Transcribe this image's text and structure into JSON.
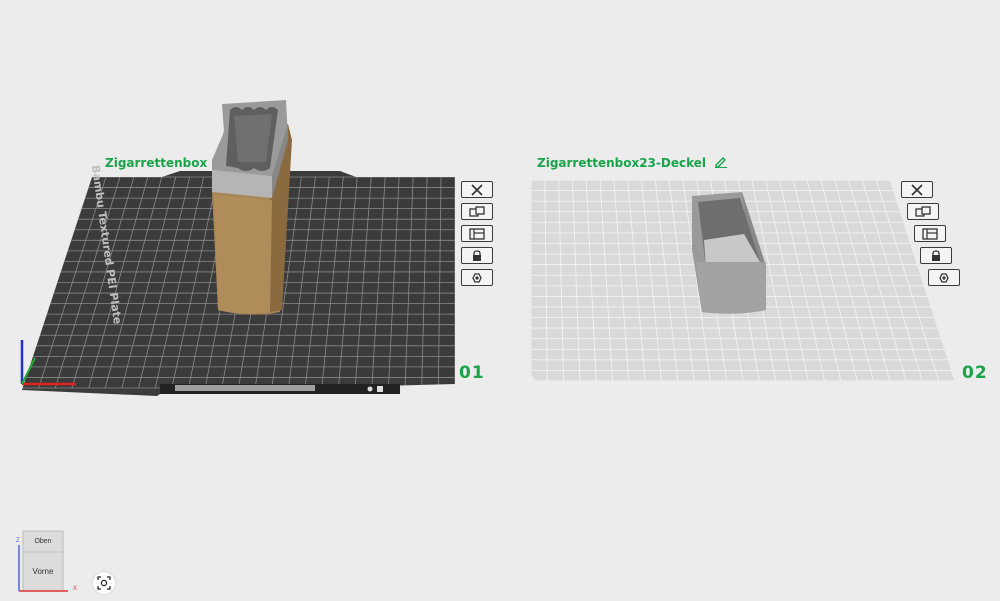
{
  "plate1": {
    "name": "Zigarrettenbox",
    "number": "01",
    "bed_label": "Bambu Textured PEI Plate"
  },
  "plate2": {
    "name": "Zigarrettenbox23-Deckel",
    "number": "02"
  },
  "plate_tools": [
    {
      "icon": "close-icon",
      "label": "Remove plate"
    },
    {
      "icon": "arrange-icon",
      "label": "Arrange"
    },
    {
      "icon": "orient-icon",
      "label": "Auto orient"
    },
    {
      "icon": "lock-icon",
      "label": "Lock"
    },
    {
      "icon": "settings-icon",
      "label": "Plate settings"
    }
  ],
  "view_cube": {
    "top_label": "Oben",
    "front_label": "Vorne"
  },
  "axes": {
    "x_label": "X",
    "z_label": "Z"
  },
  "colors": {
    "accent": "#1aa34a",
    "bed_dark": "#3b3b3b",
    "bed_light": "#d9d9d9",
    "object_box": "#a98553",
    "object_grey": "#9a9a9a",
    "background": "#ececec"
  }
}
